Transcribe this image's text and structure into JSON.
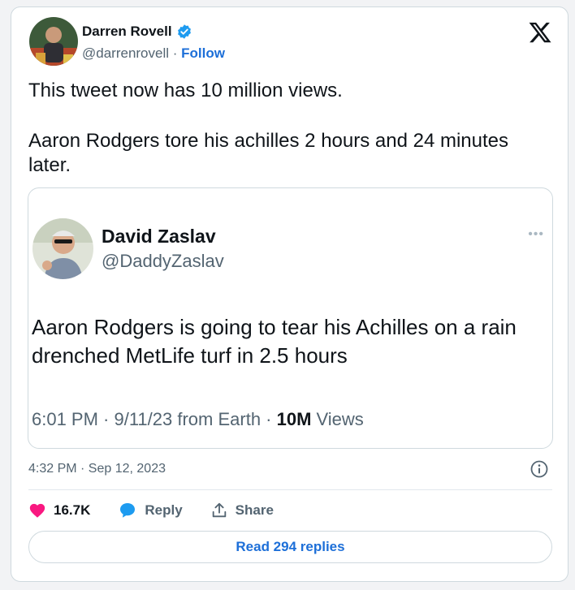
{
  "tweet": {
    "author_name": "Darren Rovell",
    "author_handle": "@darrenrovell",
    "separator": " · ",
    "follow_label": "Follow",
    "text_line1": "This tweet now has 10 million views.",
    "text_line2": "Aaron Rodgers tore his achilles 2 hours and 24 minutes later.",
    "timestamp": "4:32 PM · Sep 12, 2023",
    "likes": "16.7K",
    "reply_label": "Reply",
    "share_label": "Share",
    "read_replies_label": "Read 294 replies"
  },
  "quoted": {
    "author_name": "David Zaslav",
    "author_handle": "@DaddyZaslav",
    "dots": "•••",
    "text": "Aaron Rodgers is going to tear his Achilles on a rain drenched MetLife turf in 2.5 hours",
    "meta_prefix": "6:01 PM · 9/11/23 from Earth · ",
    "views_count": "10M",
    "views_label": " Views"
  },
  "colors": {
    "like": "#f91880",
    "reply": "#1d9bf0",
    "link": "#1d6fd8",
    "verified": "#1d9bf0"
  },
  "icons": [
    "x-logo-icon",
    "verified-badge-icon",
    "info-icon",
    "heart-icon",
    "reply-bubble-icon",
    "share-icon"
  ]
}
